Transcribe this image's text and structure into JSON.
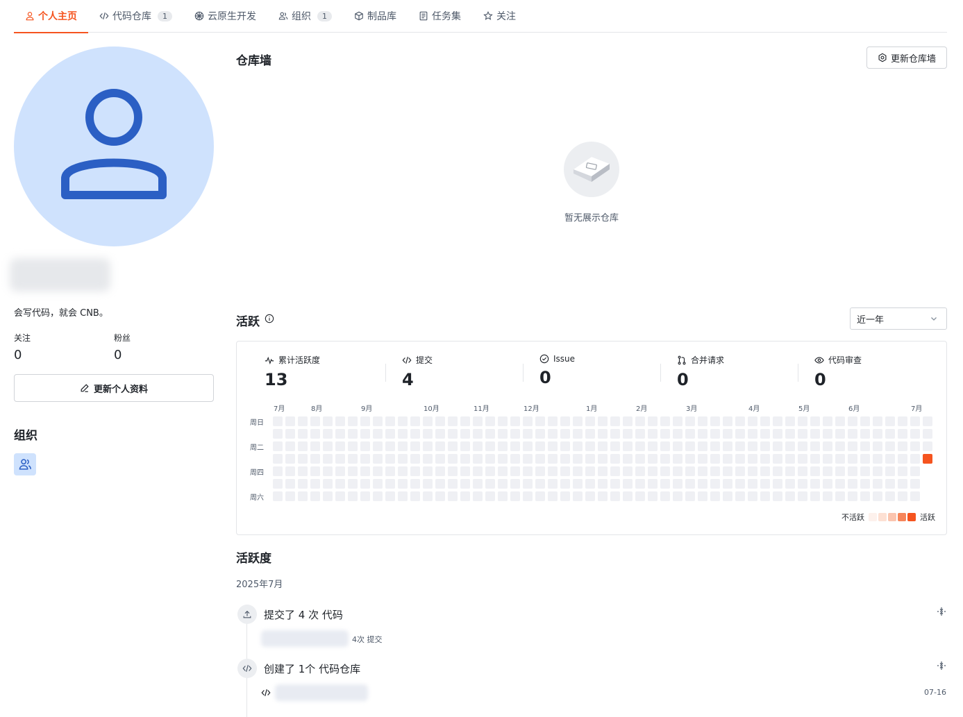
{
  "tabs": [
    {
      "label": "个人主页",
      "icon": "user-icon",
      "active": true
    },
    {
      "label": "代码仓库",
      "icon": "code-icon",
      "badge": "1"
    },
    {
      "label": "云原生开发",
      "icon": "cloud-dev-icon"
    },
    {
      "label": "组织",
      "icon": "group-icon",
      "badge": "1"
    },
    {
      "label": "制品库",
      "icon": "package-icon"
    },
    {
      "label": "任务集",
      "icon": "task-list-icon"
    },
    {
      "label": "关注",
      "icon": "star-icon"
    }
  ],
  "profile": {
    "bio": "会写代码，就会 CNB。",
    "following_label": "关注",
    "following_count": "0",
    "followers_label": "粉丝",
    "followers_count": "0",
    "edit_button": "更新个人资料"
  },
  "org_section": {
    "title": "组织"
  },
  "repo_wall": {
    "title": "仓库墙",
    "update_button": "更新仓库墙",
    "empty_text": "暂无展示仓库"
  },
  "activity": {
    "title": "活跃",
    "range_select": "近一年",
    "metrics": [
      {
        "label": "累计活跃度",
        "value": "13",
        "icon": "activity-icon"
      },
      {
        "label": "提交",
        "value": "4",
        "icon": "code-icon"
      },
      {
        "label": "Issue",
        "value": "0",
        "icon": "check-circle-icon"
      },
      {
        "label": "合并请求",
        "value": "0",
        "icon": "merge-icon"
      },
      {
        "label": "代码审查",
        "value": "0",
        "icon": "eye-icon"
      }
    ],
    "months": [
      "7月",
      "8月",
      "9月",
      "10月",
      "11月",
      "12月",
      "1月",
      "2月",
      "3月",
      "4月",
      "5月",
      "6月",
      "7月"
    ],
    "day_labels": [
      "周日",
      "周二",
      "周四",
      "周六"
    ],
    "legend_low": "不活跃",
    "legend_high": "活跃",
    "heatmap": {
      "weeks": 53,
      "last_week_days": 4,
      "active_cell": {
        "week": 52,
        "day": 3,
        "level": 4
      },
      "colors": [
        "#eff0f4",
        "#fde7de",
        "#fbcdb9",
        "#f6a07c",
        "#f5541f"
      ]
    }
  },
  "activity_feed": {
    "title": "活跃度",
    "month": "2025年7月",
    "items": [
      {
        "title": "提交了 4 次 代码",
        "icon": "upload-icon",
        "detail": "4次 提交"
      },
      {
        "title": "创建了 1个 代码仓库",
        "icon": "code-icon",
        "date": "07-16"
      }
    ]
  }
}
